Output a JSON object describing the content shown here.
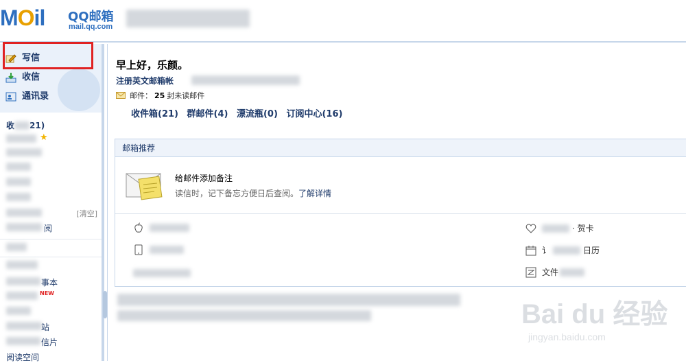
{
  "header": {
    "logo_mail": "MOil",
    "logo_qq": "QQ邮箱",
    "logo_url": "mail.qq.com"
  },
  "nav": {
    "compose": "写信",
    "inbox": "收信",
    "contacts": "通讯录"
  },
  "folders": {
    "inbox_count": "21)",
    "clear": "[清空]",
    "subscribe": "阅",
    "memo": "事本",
    "new_badge": "NEW",
    "postcard": "信片",
    "reading_space": "阅读空间",
    "station": "站"
  },
  "main": {
    "greeting": "早上好，乐颜。",
    "register_link": "注册英文邮箱帐",
    "mail_label": "邮件：",
    "mail_count": "25",
    "mail_unread": "封未读邮件",
    "folder_links": [
      "收件箱(21)",
      "群邮件(4)",
      "漂流瓶(0)",
      "订阅中心(16)"
    ]
  },
  "recommend": {
    "header": "邮箱推荐",
    "title": "给邮件添加备注",
    "desc": "读信时，记下备忘方便日后查阅。",
    "more": "了解详情"
  },
  "tools": {
    "card": "· 贺卡",
    "calendar_prefix": "讠",
    "calendar": "日历",
    "file_prefix": "文件"
  },
  "watermark": {
    "big": "Bai du 经验",
    "small": "jingyan.baidu.com"
  },
  "colors": {
    "accent": "#2e6fbf",
    "link": "#1e3a6a",
    "highlight": "#e02222"
  }
}
